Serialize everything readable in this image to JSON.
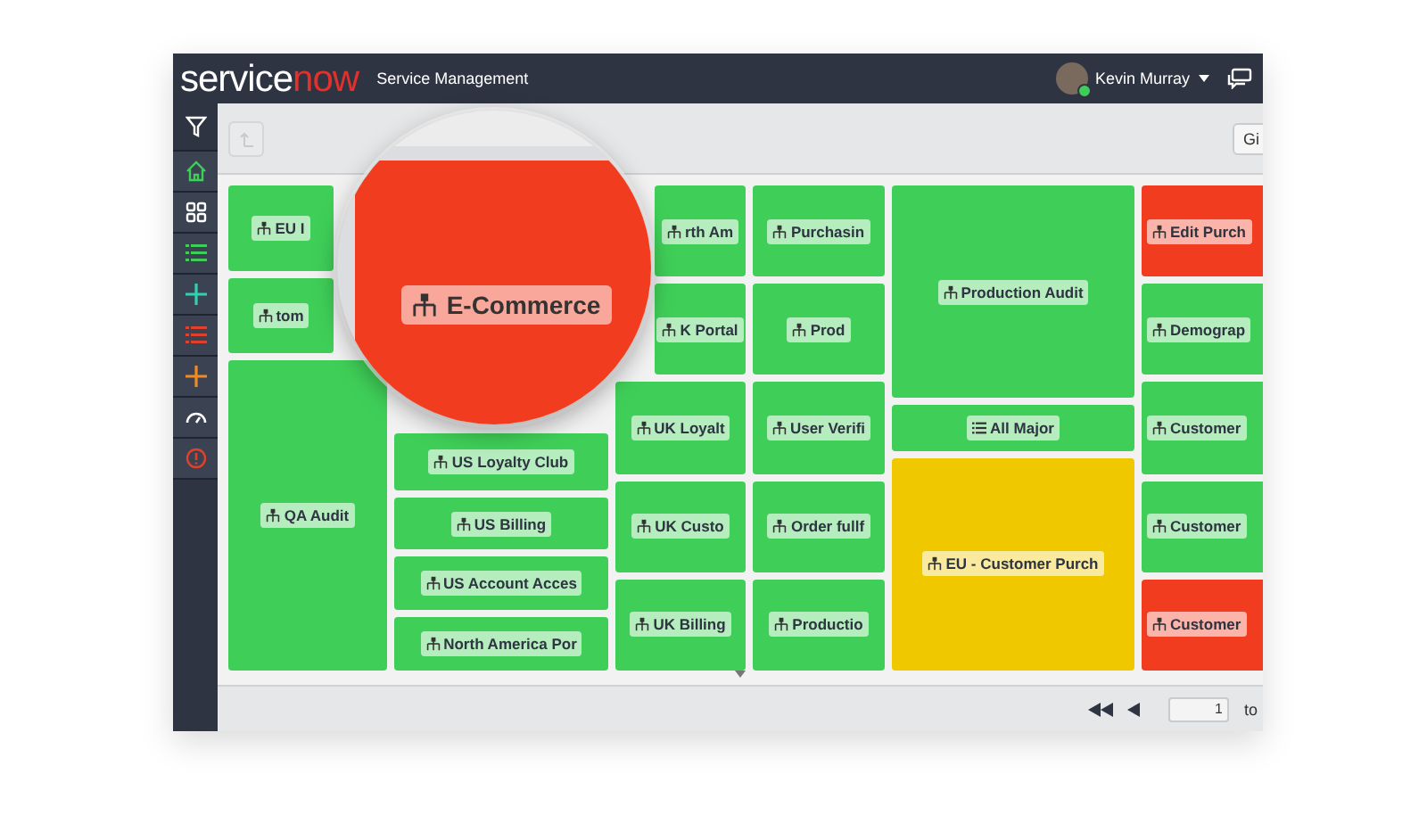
{
  "header": {
    "logo": "service",
    "logo_accent": "now",
    "app_title": "Service Management",
    "user": {
      "name": "Kevin Murray",
      "online": true
    }
  },
  "toolbar": {
    "button_cut": "Gi"
  },
  "treemap": {
    "columns": [
      {
        "tiles": [
          {
            "label": "EU I",
            "kind": "service",
            "color": "#3fcf58"
          },
          {
            "label": "tom",
            "kind": "service",
            "color": "#3fcf58"
          },
          {
            "label": "QA Audit",
            "kind": "service",
            "color": "#3fcf58"
          }
        ]
      },
      {
        "tiles": [
          {
            "label": "US Loyalty Club",
            "kind": "service",
            "color": "#3fcf58"
          },
          {
            "label": "US Billing",
            "kind": "service",
            "color": "#3fcf58"
          },
          {
            "label": "US Account Acces",
            "kind": "service",
            "color": "#3fcf58"
          },
          {
            "label": "North America Por",
            "kind": "service",
            "color": "#3fcf58"
          }
        ]
      },
      {
        "tiles": [
          {
            "label": "rth Am",
            "kind": "service",
            "color": "#3fcf58"
          },
          {
            "label": "K Portal",
            "kind": "service",
            "color": "#3fcf58"
          },
          {
            "label": "UK Loyalt",
            "kind": "service",
            "color": "#3fcf58"
          },
          {
            "label": "UK Custo",
            "kind": "service",
            "color": "#3fcf58"
          },
          {
            "label": "UK Billing",
            "kind": "service",
            "color": "#3fcf58"
          }
        ]
      },
      {
        "tiles": [
          {
            "label": "Purchasin",
            "kind": "service",
            "color": "#3fcf58"
          },
          {
            "label": "Prod",
            "kind": "service",
            "color": "#3fcf58"
          },
          {
            "label": "User Verifi",
            "kind": "service",
            "color": "#3fcf58"
          },
          {
            "label": "Order fullf",
            "kind": "service",
            "color": "#3fcf58"
          },
          {
            "label": "Productio",
            "kind": "service",
            "color": "#3fcf58"
          }
        ]
      },
      {
        "tiles": [
          {
            "label": "Production Audit",
            "kind": "service",
            "color": "#3fcf58"
          },
          {
            "label": "All Major",
            "kind": "list",
            "color": "#3fcf58"
          },
          {
            "label": "EU - Customer Purch",
            "kind": "service",
            "color": "#f0c800"
          }
        ]
      },
      {
        "tiles": [
          {
            "label": "Edit Purch",
            "kind": "service",
            "color": "#f23c1f"
          },
          {
            "label": "Demograp",
            "kind": "service",
            "color": "#3fcf58"
          },
          {
            "label": "Customer",
            "kind": "service",
            "color": "#3fcf58"
          },
          {
            "label": "Customer",
            "kind": "service",
            "color": "#3fcf58"
          },
          {
            "label": "Customer",
            "kind": "service",
            "color": "#f23c1f"
          }
        ]
      }
    ]
  },
  "magnifier": {
    "label": "E-Commerce",
    "kind": "service",
    "color": "#f23c1f"
  },
  "pager": {
    "page": "1",
    "to_cut": "to"
  }
}
